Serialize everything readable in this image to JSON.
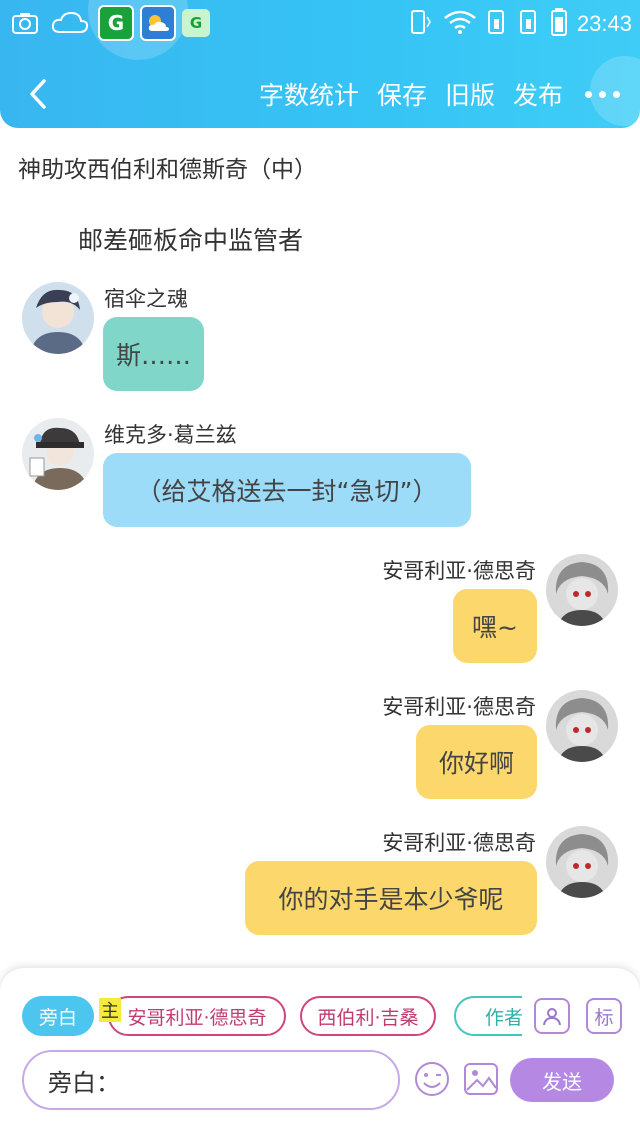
{
  "status_bar": {
    "time": "23:43"
  },
  "nav": {
    "actions": [
      "字数统计",
      "保存",
      "旧版",
      "发布"
    ]
  },
  "chapter_title": "神助攻西伯利和德斯奇（中）",
  "narration": "邮差砸板命中监管者",
  "messages": [
    {
      "speaker": "宿伞之魂",
      "text": "斯……",
      "side": "left",
      "color": "#7fd6c9"
    },
    {
      "speaker": "维克多·葛兰兹",
      "text": "（给艾格送去一封“急切”）",
      "side": "left",
      "color": "#9cdcf8"
    },
    {
      "speaker": "安哥利亚·德思奇",
      "text": "嘿~",
      "side": "right",
      "color": "#fcd86c"
    },
    {
      "speaker": "安哥利亚·德思奇",
      "text": "你好啊",
      "side": "right",
      "color": "#fcd86c"
    },
    {
      "speaker": "安哥利亚·德思奇",
      "text": "你的对手是本少爷呢",
      "side": "right",
      "color": "#fcd86c"
    }
  ],
  "composer": {
    "chips": [
      "旁白",
      "安哥利亚·德思奇",
      "西伯利·吉桑",
      "作者"
    ],
    "main_tag": "主",
    "tag_button": "标",
    "input_value": "旁白：",
    "send_label": "发送"
  },
  "colors": {
    "header": "#38b6f0",
    "accent_purple": "#b588e4",
    "chip_pink": "#d0457c",
    "chip_teal": "#45c6bd"
  }
}
